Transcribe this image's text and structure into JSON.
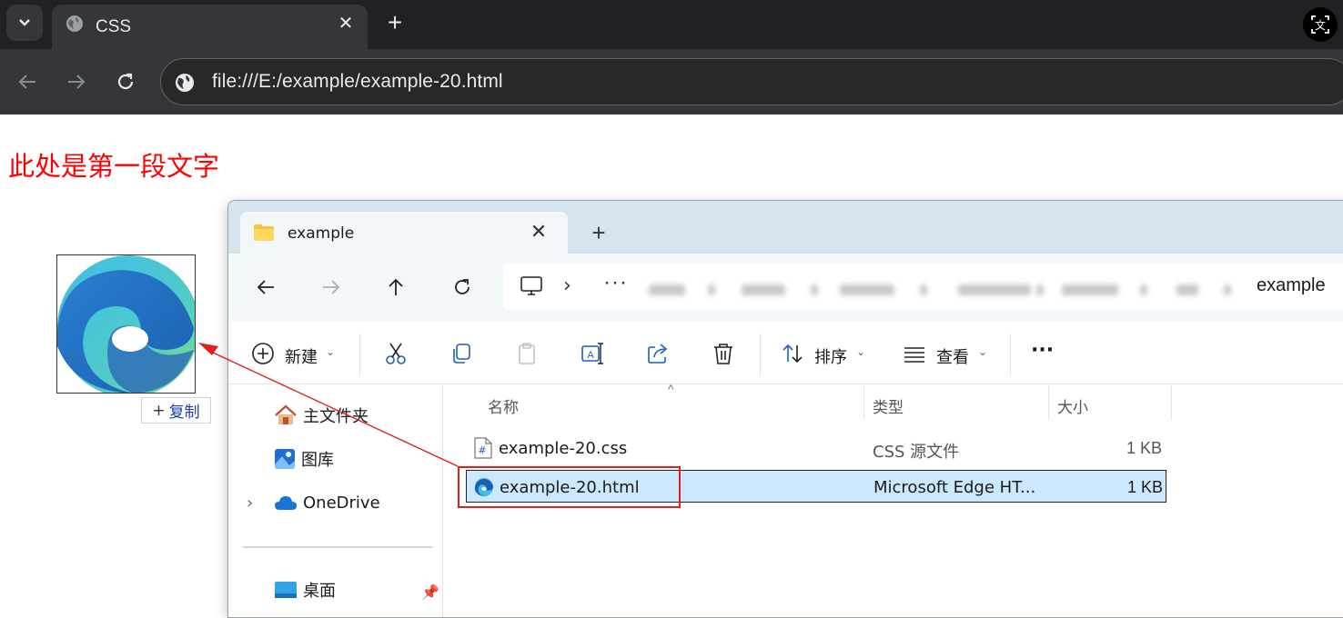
{
  "browser": {
    "tab_title": "CSS",
    "tab_close": "✕",
    "new_tab": "+",
    "url": "file:///E:/example/example-20.html"
  },
  "page": {
    "heading": "此处是第一段文字",
    "copy_badge_plus": "+",
    "copy_badge_label": "复制"
  },
  "explorer": {
    "tab_title": "example",
    "tab_close": "✕",
    "new_tab": "+",
    "breadcrumb_more": "···",
    "breadcrumb_current": "example",
    "commands": {
      "new_label": "新建",
      "sort_label": "排序",
      "view_label": "查看",
      "more_label": "···"
    },
    "nav_items": [
      {
        "label": "主文件夹"
      },
      {
        "label": "图库"
      },
      {
        "label": "OneDrive"
      },
      {
        "label": "桌面"
      }
    ],
    "columns": {
      "name": "名称",
      "type": "类型",
      "size": "大小"
    },
    "files": [
      {
        "name": "example-20.css",
        "type": "CSS 源文件",
        "size": "1 KB"
      },
      {
        "name": "example-20.html",
        "type": "Microsoft Edge HT...",
        "size": "1 KB"
      }
    ]
  },
  "colors": {
    "heading": "#ff0000",
    "annotation": "#e0201c",
    "selection": "#cce8ff"
  }
}
